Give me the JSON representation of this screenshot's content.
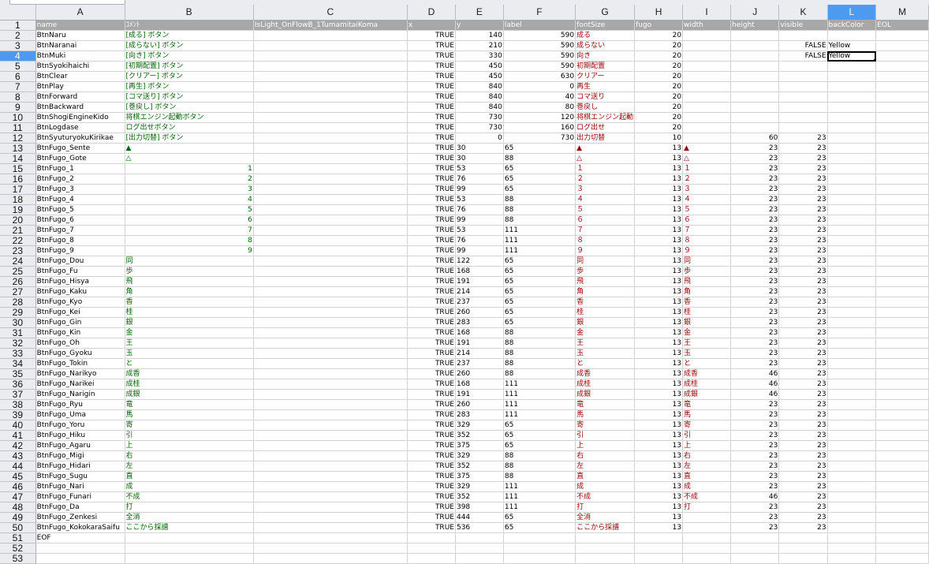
{
  "columns": [
    "A",
    "B",
    "C",
    "D",
    "E",
    "F",
    "G",
    "H",
    "I",
    "J",
    "K",
    "L",
    "M"
  ],
  "selected_column": "L",
  "selected_row": 4,
  "header_row": [
    "name",
    "ｺﾒﾝﾄ",
    "IsLight_OnFlowB_1TumamitaiKoma",
    "x",
    "y",
    "label",
    "fontSize",
    "fugo",
    "width",
    "height",
    "visible",
    "backColor",
    "EOL"
  ],
  "rows": [
    [
      "BtnNaru",
      "[成る] ボタン",
      "",
      "TRUE",
      "140",
      "590",
      "成る",
      "20",
      "",
      "",
      "",
      "",
      ""
    ],
    [
      "BtnNaranai",
      "[成らない] ボタン",
      "",
      "TRUE",
      "210",
      "590",
      "成らない",
      "20",
      "",
      "",
      "FALSE",
      "Yellow",
      ""
    ],
    [
      "BtnMuki",
      "[向き] ボタン",
      "",
      "TRUE",
      "330",
      "590",
      "向き",
      "20",
      "",
      "",
      "FALSE",
      "Yellow",
      ""
    ],
    [
      "BtnSyokihaichi",
      "[初期配置] ボタン",
      "",
      "TRUE",
      "450",
      "590",
      "初期配置",
      "20",
      "",
      "",
      "",
      "",
      ""
    ],
    [
      "BtnClear",
      "[クリアー] ボタン",
      "",
      "TRUE",
      "450",
      "630",
      "クリアー",
      "20",
      "",
      "",
      "",
      "",
      ""
    ],
    [
      "BtnPlay",
      "[再生] ボタン",
      "",
      "TRUE",
      "840",
      "0",
      "再生",
      "20",
      "",
      "",
      "",
      "",
      ""
    ],
    [
      "BtnForward",
      "[コマ送り] ボタン",
      "",
      "TRUE",
      "840",
      "40",
      "コマ送り",
      "20",
      "",
      "",
      "",
      "",
      ""
    ],
    [
      "BtnBackward",
      "[巻戻し] ボタン",
      "",
      "TRUE",
      "840",
      "80",
      "巻戻し",
      "20",
      "",
      "",
      "",
      "",
      ""
    ],
    [
      "BtnShogiEngineKido",
      "将棋エンジン起動ボタン",
      "",
      "TRUE",
      "730",
      "120",
      "将棋エンジン起動",
      "20",
      "",
      "",
      "",
      "",
      ""
    ],
    [
      "BtnLogdase",
      "ログ出せボタン",
      "",
      "TRUE",
      "730",
      "160",
      "ログ出せ",
      "20",
      "",
      "",
      "",
      "",
      ""
    ],
    [
      "BtnSyuturyokuKirikae",
      "[出力切替] ボタン",
      "",
      "TRUE",
      "0",
      "730",
      "出力切替",
      "10",
      "",
      "60",
      "23",
      "",
      ""
    ],
    [
      "BtnFugo_Sente",
      "▲",
      "",
      "TRUE",
      "30",
      "65",
      "▲",
      "13",
      "▲",
      "23",
      "23",
      "",
      ""
    ],
    [
      "BtnFugo_Gote",
      "△",
      "",
      "TRUE",
      "30",
      "88",
      "△",
      "13",
      "△",
      "23",
      "23",
      "",
      ""
    ],
    [
      "BtnFugo_1",
      "1",
      "",
      "TRUE",
      "53",
      "65",
      "１",
      "13",
      "１",
      "23",
      "23",
      "",
      ""
    ],
    [
      "BtnFugo_2",
      "2",
      "",
      "TRUE",
      "76",
      "65",
      "２",
      "13",
      "２",
      "23",
      "23",
      "",
      ""
    ],
    [
      "BtnFugo_3",
      "3",
      "",
      "TRUE",
      "99",
      "65",
      "３",
      "13",
      "３",
      "23",
      "23",
      "",
      ""
    ],
    [
      "BtnFugo_4",
      "4",
      "",
      "TRUE",
      "53",
      "88",
      "４",
      "13",
      "４",
      "23",
      "23",
      "",
      ""
    ],
    [
      "BtnFugo_5",
      "5",
      "",
      "TRUE",
      "76",
      "88",
      "５",
      "13",
      "５",
      "23",
      "23",
      "",
      ""
    ],
    [
      "BtnFugo_6",
      "6",
      "",
      "TRUE",
      "99",
      "88",
      "６",
      "13",
      "６",
      "23",
      "23",
      "",
      ""
    ],
    [
      "BtnFugo_7",
      "7",
      "",
      "TRUE",
      "53",
      "111",
      "７",
      "13",
      "７",
      "23",
      "23",
      "",
      ""
    ],
    [
      "BtnFugo_8",
      "8",
      "",
      "TRUE",
      "76",
      "111",
      "８",
      "13",
      "８",
      "23",
      "23",
      "",
      ""
    ],
    [
      "BtnFugo_9",
      "9",
      "",
      "TRUE",
      "99",
      "111",
      "９",
      "13",
      "９",
      "23",
      "23",
      "",
      ""
    ],
    [
      "BtnFugo_Dou",
      "同",
      "",
      "TRUE",
      "122",
      "65",
      "同",
      "13",
      "同",
      "23",
      "23",
      "",
      ""
    ],
    [
      "BtnFugo_Fu",
      "歩",
      "",
      "TRUE",
      "168",
      "65",
      "歩",
      "13",
      "歩",
      "23",
      "23",
      "",
      ""
    ],
    [
      "BtnFugo_Hisya",
      "飛",
      "",
      "TRUE",
      "191",
      "65",
      "飛",
      "13",
      "飛",
      "23",
      "23",
      "",
      ""
    ],
    [
      "BtnFugo_Kaku",
      "角",
      "",
      "TRUE",
      "214",
      "65",
      "角",
      "13",
      "角",
      "23",
      "23",
      "",
      ""
    ],
    [
      "BtnFugo_Kyo",
      "香",
      "",
      "TRUE",
      "237",
      "65",
      "香",
      "13",
      "香",
      "23",
      "23",
      "",
      ""
    ],
    [
      "BtnFugo_Kei",
      "桂",
      "",
      "TRUE",
      "260",
      "65",
      "桂",
      "13",
      "桂",
      "23",
      "23",
      "",
      ""
    ],
    [
      "BtnFugo_Gin",
      "銀",
      "",
      "TRUE",
      "283",
      "65",
      "銀",
      "13",
      "銀",
      "23",
      "23",
      "",
      ""
    ],
    [
      "BtnFugo_Kin",
      "金",
      "",
      "TRUE",
      "168",
      "88",
      "金",
      "13",
      "金",
      "23",
      "23",
      "",
      ""
    ],
    [
      "BtnFugo_Oh",
      "王",
      "",
      "TRUE",
      "191",
      "88",
      "王",
      "13",
      "王",
      "23",
      "23",
      "",
      ""
    ],
    [
      "BtnFugo_Gyoku",
      "玉",
      "",
      "TRUE",
      "214",
      "88",
      "玉",
      "13",
      "玉",
      "23",
      "23",
      "",
      ""
    ],
    [
      "BtnFugo_Tokin",
      "と",
      "",
      "TRUE",
      "237",
      "88",
      "と",
      "13",
      "と",
      "23",
      "23",
      "",
      ""
    ],
    [
      "BtnFugo_Narikyo",
      "成香",
      "",
      "TRUE",
      "260",
      "88",
      "成香",
      "13",
      "成香",
      "46",
      "23",
      "",
      ""
    ],
    [
      "BtnFugo_Narikei",
      "成桂",
      "",
      "TRUE",
      "168",
      "111",
      "成桂",
      "13",
      "成桂",
      "46",
      "23",
      "",
      ""
    ],
    [
      "BtnFugo_Narigin",
      "成銀",
      "",
      "TRUE",
      "191",
      "111",
      "成銀",
      "13",
      "成銀",
      "46",
      "23",
      "",
      ""
    ],
    [
      "BtnFugo_Ryu",
      "竜",
      "",
      "TRUE",
      "260",
      "111",
      "竜",
      "13",
      "竜",
      "23",
      "23",
      "",
      ""
    ],
    [
      "BtnFugo_Uma",
      "馬",
      "",
      "TRUE",
      "283",
      "111",
      "馬",
      "13",
      "馬",
      "23",
      "23",
      "",
      ""
    ],
    [
      "BtnFugo_Yoru",
      "寄",
      "",
      "TRUE",
      "329",
      "65",
      "寄",
      "13",
      "寄",
      "23",
      "23",
      "",
      ""
    ],
    [
      "BtnFugo_Hiku",
      "引",
      "",
      "TRUE",
      "352",
      "65",
      "引",
      "13",
      "引",
      "23",
      "23",
      "",
      ""
    ],
    [
      "BtnFugo_Agaru",
      "上",
      "",
      "TRUE",
      "375",
      "65",
      "上",
      "13",
      "上",
      "23",
      "23",
      "",
      ""
    ],
    [
      "BtnFugo_Migi",
      "右",
      "",
      "TRUE",
      "329",
      "88",
      "右",
      "13",
      "右",
      "23",
      "23",
      "",
      ""
    ],
    [
      "BtnFugo_Hidari",
      "左",
      "",
      "TRUE",
      "352",
      "88",
      "左",
      "13",
      "左",
      "23",
      "23",
      "",
      ""
    ],
    [
      "BtnFugo_Sugu",
      "直",
      "",
      "TRUE",
      "375",
      "88",
      "直",
      "13",
      "直",
      "23",
      "23",
      "",
      ""
    ],
    [
      "BtnFugo_Nari",
      "成",
      "",
      "TRUE",
      "329",
      "111",
      "成",
      "13",
      "成",
      "23",
      "23",
      "",
      ""
    ],
    [
      "BtnFugo_Funari",
      "不成",
      "",
      "TRUE",
      "352",
      "111",
      "不成",
      "13",
      "不成",
      "46",
      "23",
      "",
      ""
    ],
    [
      "BtnFugo_Da",
      "打",
      "",
      "TRUE",
      "398",
      "111",
      "打",
      "13",
      "打",
      "23",
      "23",
      "",
      ""
    ],
    [
      "BtnFugo_Zenkesi",
      "全消",
      "",
      "TRUE",
      "444",
      "65",
      "全消",
      "13",
      "",
      "23",
      "23",
      "",
      ""
    ],
    [
      "BtnFugo_KokokaraSaifu",
      "ここから採譜",
      "",
      "TRUE",
      "536",
      "65",
      "ここから採譜",
      "13",
      "",
      "23",
      "23",
      "",
      ""
    ],
    [
      "EOF",
      "",
      "",
      "",
      "",
      "",
      "",
      "",
      "",
      "",
      "",
      "",
      ""
    ],
    [
      "",
      "",
      "",
      "",
      "",
      "",
      "",
      "",
      "",
      "",
      "",
      "",
      ""
    ],
    [
      "",
      "",
      "",
      "",
      "",
      "",
      "",
      "",
      "",
      "",
      "",
      "",
      ""
    ]
  ]
}
